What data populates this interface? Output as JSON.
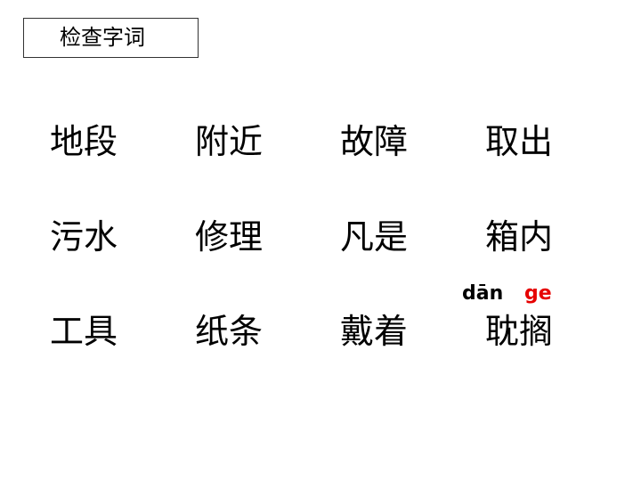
{
  "title": "检查字词",
  "rows": [
    [
      "地段",
      "附近",
      "故障",
      "取出"
    ],
    [
      "污水",
      "修理",
      "凡是",
      "箱内"
    ],
    [
      "工具",
      "纸条",
      "戴着",
      "耽搁"
    ]
  ],
  "pinyin": {
    "syllable1": "dān",
    "syllable2": "ge",
    "syllable1_color": "#000000",
    "syllable2_color": "#e60000"
  }
}
